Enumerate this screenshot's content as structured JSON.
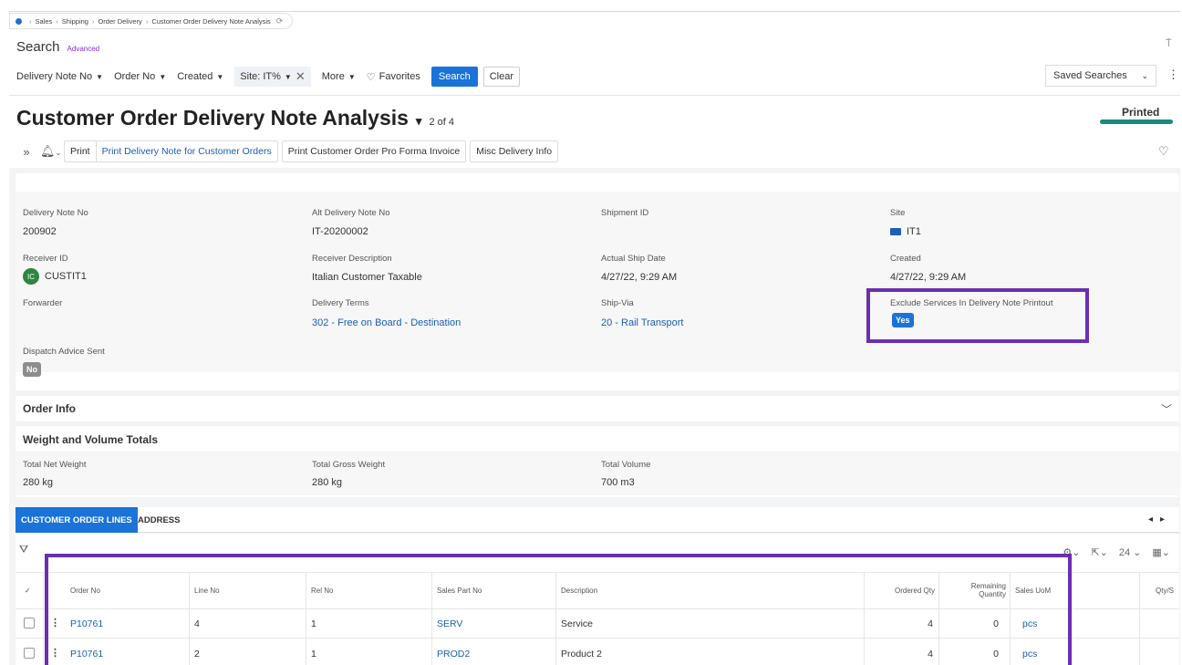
{
  "breadcrumb": {
    "items": [
      "Sales",
      "Shipping",
      "Order Delivery",
      "Customer Order Delivery Note Analysis"
    ]
  },
  "search": {
    "title": "Search",
    "advanced": "Advanced",
    "filters": {
      "delivery_note_no": "Delivery Note No",
      "order_no": "Order No",
      "created": "Created",
      "site": "Site: IT%",
      "more": "More",
      "favorites": "Favorites"
    },
    "search_btn": "Search",
    "clear_btn": "Clear",
    "saved_searches": "Saved Searches"
  },
  "page": {
    "title": "Customer Order Delivery Note Analysis",
    "record_count": "2 of 4",
    "status": "Printed",
    "status_color": "#1b8a7e"
  },
  "commands": {
    "print": "Print",
    "print_delivery_note": "Print Delivery Note for Customer Orders",
    "print_pro_forma": "Print Customer Order Pro Forma Invoice",
    "misc_delivery_info": "Misc Delivery Info"
  },
  "fields": {
    "delivery_note_no": {
      "label": "Delivery Note No",
      "value": "200902"
    },
    "alt_delivery_note_no": {
      "label": "Alt Delivery Note No",
      "value": "IT-20200002"
    },
    "shipment_id": {
      "label": "Shipment ID",
      "value": ""
    },
    "site": {
      "label": "Site",
      "value": "IT1"
    },
    "receiver_id": {
      "label": "Receiver ID",
      "value": "CUSTIT1",
      "avatar": "IC"
    },
    "receiver_description": {
      "label": "Receiver Description",
      "value": "Italian Customer Taxable"
    },
    "actual_ship_date": {
      "label": "Actual Ship Date",
      "value": "4/27/22, 9:29 AM"
    },
    "created": {
      "label": "Created",
      "value": "4/27/22, 9:29 AM"
    },
    "forwarder": {
      "label": "Forwarder",
      "value": ""
    },
    "delivery_terms": {
      "label": "Delivery Terms",
      "value": "302 - Free on Board - Destination"
    },
    "ship_via": {
      "label": "Ship-Via",
      "value": "20 - Rail Transport"
    },
    "exclude_services": {
      "label": "Exclude Services In Delivery Note Printout",
      "value": "Yes"
    },
    "dispatch_advice_sent": {
      "label": "Dispatch Advice Sent",
      "value": "No"
    }
  },
  "sections": {
    "order_info": "Order Info",
    "weight_volume": "Weight and Volume Totals"
  },
  "totals": {
    "net_weight": {
      "label": "Total Net Weight",
      "value": "280 kg"
    },
    "gross_weight": {
      "label": "Total Gross Weight",
      "value": "280 kg"
    },
    "volume": {
      "label": "Total Volume",
      "value": "700 m3"
    }
  },
  "tabs": [
    "CUSTOMER ORDER LINES",
    "ADDRESS"
  ],
  "table": {
    "page_size": "24",
    "columns": [
      "Order No",
      "Line No",
      "Rel No",
      "Sales Part No",
      "Description",
      "Ordered Qty",
      "Remaining Quantity",
      "Sales UoM",
      "Qty/S"
    ],
    "rows": [
      {
        "order_no": "P10761",
        "line_no": "4",
        "rel_no": "1",
        "sales_part_no": "SERV",
        "description": "Service",
        "ordered_qty": "4",
        "remaining_qty": "0",
        "sales_uom": "pcs"
      },
      {
        "order_no": "P10761",
        "line_no": "2",
        "rel_no": "1",
        "sales_part_no": "PROD2",
        "description": "Product 2",
        "ordered_qty": "4",
        "remaining_qty": "0",
        "sales_uom": "pcs"
      }
    ]
  },
  "colors": {
    "accent": "#1a73d9",
    "highlight": "#6a2fb0"
  }
}
